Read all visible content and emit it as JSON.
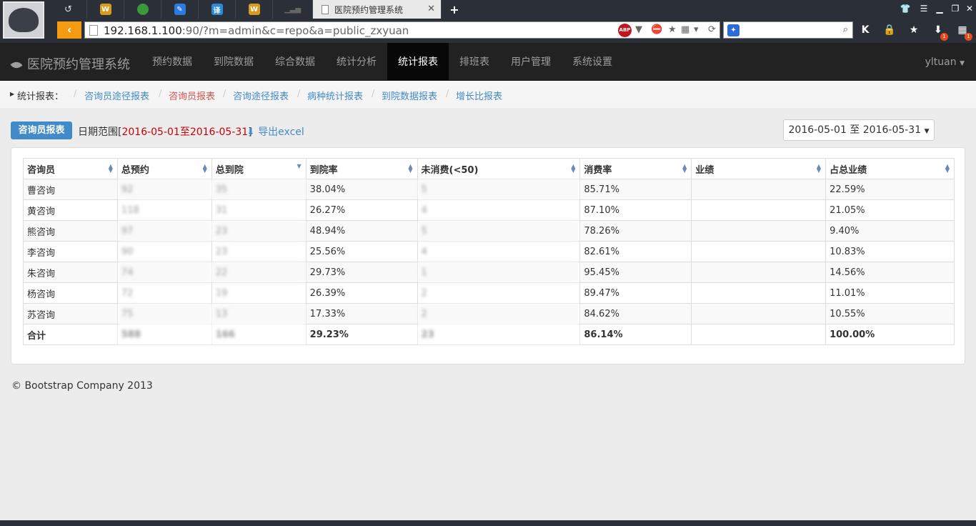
{
  "browser": {
    "active_tab_title": "医院预约管理系统",
    "url_host": "192.168.1.100",
    "url_rest": ":90/?m=admin&c=repo&a=public_zxyuan",
    "new_tab": "+",
    "badges": [
      "1",
      "1"
    ]
  },
  "nav": {
    "brand": "医院预约管理系统",
    "items": [
      "预约数据",
      "到院数据",
      "综合数据",
      "统计分析",
      "统计报表",
      "排班表",
      "用户管理",
      "系统设置"
    ],
    "active_index": 4,
    "user": "yltuan"
  },
  "breadcrumb": {
    "label": "统计报表：",
    "items": [
      "咨询员途径报表",
      "咨询员报表",
      "咨询途径报表",
      "病种统计报表",
      "到院数据报表",
      "增长比报表"
    ],
    "active_index": 1
  },
  "toolbar": {
    "report_label": "咨询员报表",
    "range_prefix": "日期范围[",
    "range_value": "2016-05-01至2016-05-31",
    "range_suffix": "]",
    "export": "导出excel",
    "date_picker": "2016-05-01 至 2016-05-31"
  },
  "table": {
    "headers": [
      "咨询员",
      "总预约",
      "总到院",
      "到院率",
      "未消费(<50)",
      "消费率",
      "业绩",
      "占总业绩"
    ],
    "rows": [
      [
        "曹咨询",
        "92",
        "35",
        "38.04%",
        "5",
        "85.71%",
        "",
        "22.59%"
      ],
      [
        "黄咨询",
        "118",
        "31",
        "26.27%",
        "4",
        "87.10%",
        "",
        "21.05%"
      ],
      [
        "熊咨询",
        "97",
        "23",
        "48.94%",
        "5",
        "78.26%",
        "",
        "9.40%"
      ],
      [
        "李咨询",
        "90",
        "23",
        "25.56%",
        "4",
        "82.61%",
        "",
        "10.83%"
      ],
      [
        "朱咨询",
        "74",
        "22",
        "29.73%",
        "1",
        "95.45%",
        "",
        "14.56%"
      ],
      [
        "杨咨询",
        "72",
        "19",
        "26.39%",
        "2",
        "89.47%",
        "",
        "11.01%"
      ],
      [
        "苏咨询",
        "75",
        "13",
        "17.33%",
        "2",
        "84.62%",
        "",
        "10.55%"
      ]
    ],
    "total": [
      "合计",
      "588",
      "166",
      "29.23%",
      "23",
      "86.14%",
      "",
      "100.00%"
    ]
  },
  "footer": "© Bootstrap Company 2013",
  "colors": {
    "primary": "#428bca",
    "navbar": "#222222",
    "accent": "#f39c12",
    "danger": "#d9534f"
  }
}
